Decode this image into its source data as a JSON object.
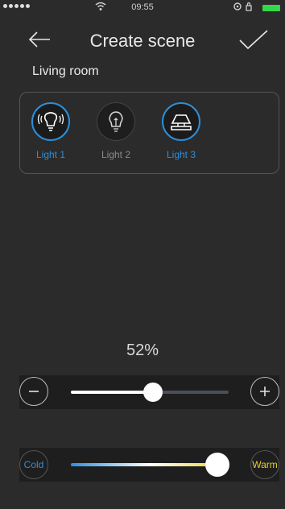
{
  "status_bar": {
    "time": "09:55",
    "wifi_icon": "wifi-icon",
    "battery_color": "#35d64c"
  },
  "header": {
    "title": "Create scene",
    "back_icon": "arrow-left-icon",
    "confirm_icon": "checkmark-icon"
  },
  "room": {
    "name": "Living room"
  },
  "lights": [
    {
      "label": "Light 1",
      "icon": "wave-bulb-icon",
      "selected": true
    },
    {
      "label": "Light 2",
      "icon": "bulb-icon",
      "selected": false
    },
    {
      "label": "Light 3",
      "icon": "lamp-icon",
      "selected": true
    }
  ],
  "brightness": {
    "percent_label": "52%",
    "value_fraction": 0.52,
    "minus_icon": "minus-icon",
    "plus_icon": "plus-icon"
  },
  "color_temperature": {
    "cold_label": "Cold",
    "warm_label": "Warm",
    "value_fraction": 0.93,
    "cold_color": "#2f8fe0",
    "warm_color": "#e8cf2a"
  },
  "colors": {
    "accent": "#2b8fd8",
    "background": "#2b2b2b"
  }
}
